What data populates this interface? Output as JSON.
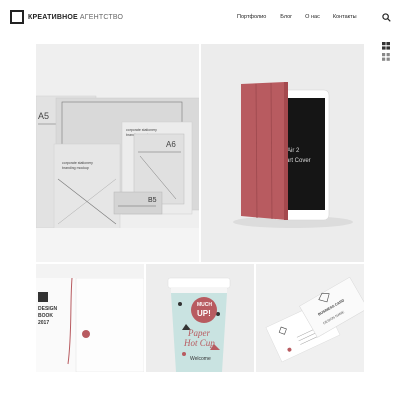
{
  "header": {
    "logo_bold": "КРЕАТИВНОЕ",
    "logo_light": "АГЕНТСТВО",
    "nav": {
      "portfolio": "Портфолио",
      "blog": "Блог",
      "about": "О нас",
      "contacts": "Контакты"
    }
  },
  "portfolio": {
    "tile1": {
      "card1_label": "A5",
      "card2_line1": "corporate stationery",
      "card2_line2": "branding mockup",
      "card3_line1": "corporate stationery",
      "card3_line2": "branding mockup",
      "card3_label": "A6",
      "card4_label": "B5"
    },
    "tile2": {
      "line1": "Air 2",
      "line2": "mart Cover"
    },
    "tile3": {
      "line1": "DESIGN",
      "line2": "BOOK",
      "line3": "2017"
    },
    "tile4": {
      "cup_top": "MUCH",
      "cup_up": "UP!",
      "cup_line1": "Paper",
      "cup_line2": "Hot Cup",
      "cup_welcome": "Welcome"
    },
    "tile5": {
      "card_top": "BUSINESS CARD",
      "card_name": "DESIGN NAME"
    }
  },
  "colors": {
    "accent": "#b85b60",
    "dark": "#222222"
  },
  "icons": {
    "search": "search-icon",
    "list_view": "list-view-icon",
    "grid_view": "grid-view-icon"
  }
}
